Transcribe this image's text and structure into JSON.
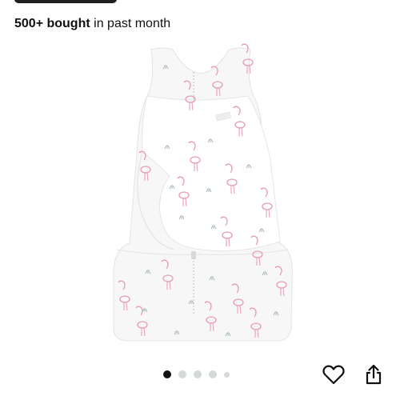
{
  "purchase_stats": {
    "count_label": "500+ bought",
    "suffix": "in past month"
  },
  "product_image": {
    "subject": "white sleeveless baby swaddle sack with pink flamingo print",
    "print_color": "#e79ab8",
    "grass_color": "#9fb3b0"
  },
  "carousel": {
    "total": 5,
    "active_index": 0
  },
  "actions": {
    "wishlist_icon": "heart-outline-icon",
    "share_icon": "share-icon"
  },
  "colors": {
    "text": "#0f1111",
    "dot_inactive": "#d5d9d9",
    "dot_active": "#0f1111"
  }
}
